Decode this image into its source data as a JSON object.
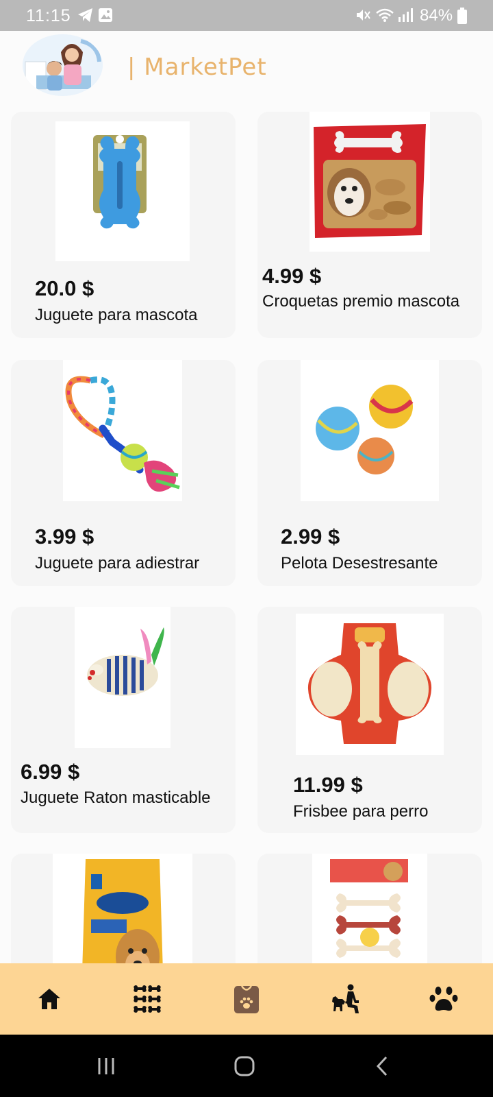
{
  "status_bar": {
    "time": "11:15",
    "battery": "84%"
  },
  "header": {
    "brand": "| MarketPet"
  },
  "products": [
    {
      "price": "20.0 $",
      "name": "Juguete para mascota",
      "image": "blue-bone-toy"
    },
    {
      "price": "4.99 $",
      "name": "Croquetas premio mascota",
      "image": "dog-treat-bag"
    },
    {
      "price": "3.99 $",
      "name": "Juguete para adiestrar",
      "image": "rope-ball-toy"
    },
    {
      "price": "2.99 $",
      "name": "Pelota Desestresante",
      "image": "three-balls"
    },
    {
      "price": "6.99 $",
      "name": "Juguete Raton masticable",
      "image": "mouse-toy"
    },
    {
      "price": "11.99 $",
      "name": "Frisbee para perro",
      "image": "frisbee-bone-pack"
    },
    {
      "price": "",
      "name": "",
      "image": "pedigree-food-bag"
    },
    {
      "price": "",
      "name": "",
      "image": "bone-treats-pack"
    }
  ],
  "bottom_nav": {
    "items": [
      "home-icon",
      "bones-grid-icon",
      "pet-bag-icon",
      "person-dog-icon",
      "paw-icon"
    ],
    "active_index": 2
  },
  "colors": {
    "accent": "#fdd594",
    "brand_text": "#e8b36c",
    "card_bg": "#f5f5f5",
    "nav_icon": "#111111",
    "active_icon": "#7a5a46"
  }
}
